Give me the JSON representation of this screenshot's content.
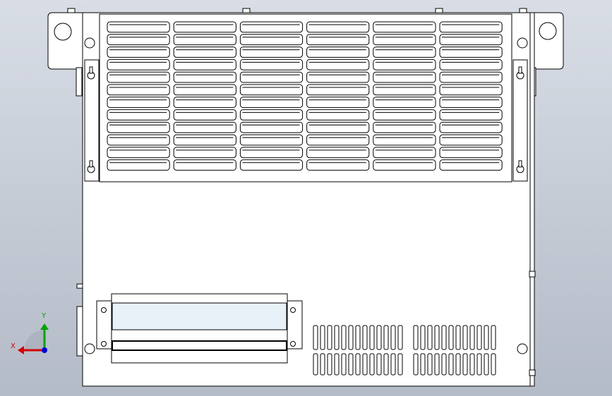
{
  "viewport": {
    "background_top": "#d8dde6",
    "background_bottom": "#b4bbc8"
  },
  "model": {
    "line_color": "#000000",
    "face_color": "#ffffff",
    "display_panel_color": "#e8f0f8",
    "fan_grille": {
      "rows": 12,
      "columns": 6
    },
    "bottom_vents": {
      "left_group_slots": 13,
      "right_group_slots": 12,
      "rows": 2
    }
  },
  "triad": {
    "x_label": "X",
    "y_label": "Y",
    "x_color": "#d40000",
    "y_color": "#00a000",
    "z_color": "#0000d0"
  }
}
